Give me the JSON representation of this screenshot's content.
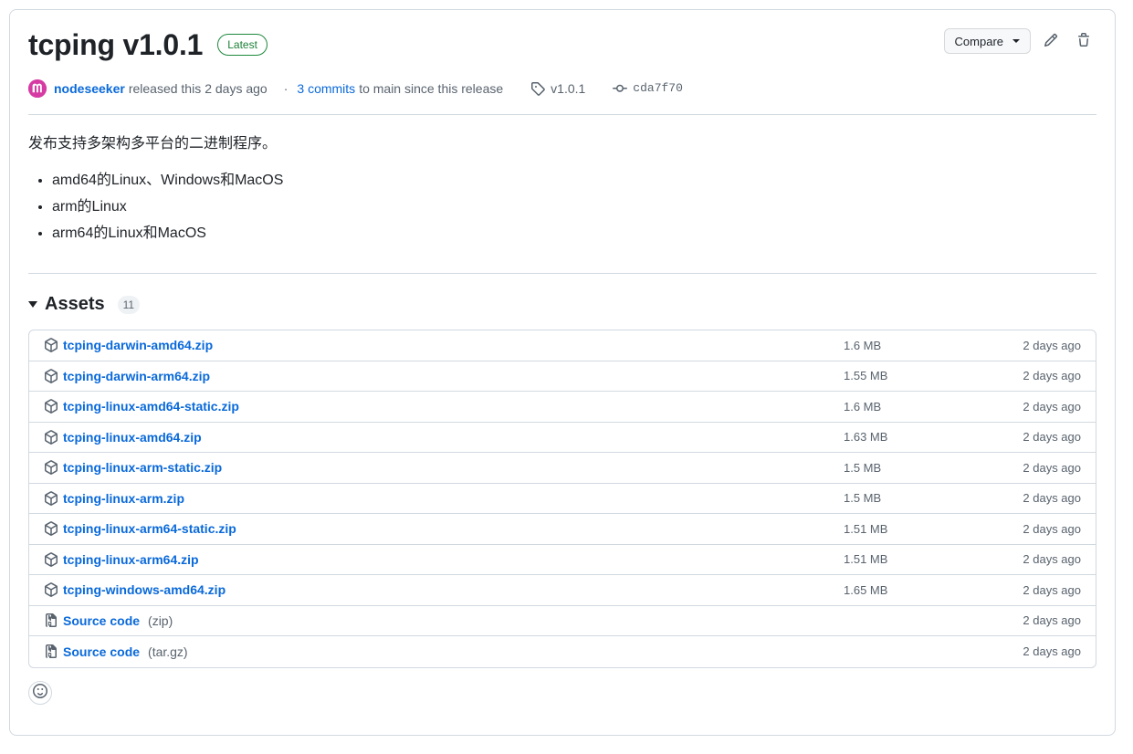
{
  "release": {
    "title": "tcping v1.0.1",
    "latest_badge": "Latest",
    "author": "nodeseeker",
    "released_text": "released this",
    "released_when": "2 days ago",
    "meta_separator": "·",
    "commits_link": "3 commits",
    "commits_tail": "to main since this release",
    "tag_name": "v1.0.1",
    "commit_hash": "cda7f70"
  },
  "actions": {
    "compare_label": "Compare",
    "edit_title": "Edit release",
    "delete_title": "Delete release"
  },
  "body": {
    "paragraph": "发布支持多架构多平台的二进制程序。",
    "bullets": [
      "amd64的Linux、Windows和MacOS",
      "arm的Linux",
      "arm64的Linux和MacOS"
    ]
  },
  "assets": {
    "heading": "Assets",
    "count": "11",
    "rows": [
      {
        "name": "tcping-darwin-amd64.zip",
        "suffix": "",
        "size": "1.6 MB",
        "date": "2 days ago",
        "icon": "package-icon"
      },
      {
        "name": "tcping-darwin-arm64.zip",
        "suffix": "",
        "size": "1.55 MB",
        "date": "2 days ago",
        "icon": "package-icon"
      },
      {
        "name": "tcping-linux-amd64-static.zip",
        "suffix": "",
        "size": "1.6 MB",
        "date": "2 days ago",
        "icon": "package-icon"
      },
      {
        "name": "tcping-linux-amd64.zip",
        "suffix": "",
        "size": "1.63 MB",
        "date": "2 days ago",
        "icon": "package-icon"
      },
      {
        "name": "tcping-linux-arm-static.zip",
        "suffix": "",
        "size": "1.5 MB",
        "date": "2 days ago",
        "icon": "package-icon"
      },
      {
        "name": "tcping-linux-arm.zip",
        "suffix": "",
        "size": "1.5 MB",
        "date": "2 days ago",
        "icon": "package-icon"
      },
      {
        "name": "tcping-linux-arm64-static.zip",
        "suffix": "",
        "size": "1.51 MB",
        "date": "2 days ago",
        "icon": "package-icon"
      },
      {
        "name": "tcping-linux-arm64.zip",
        "suffix": "",
        "size": "1.51 MB",
        "date": "2 days ago",
        "icon": "package-icon"
      },
      {
        "name": "tcping-windows-amd64.zip",
        "suffix": "",
        "size": "1.65 MB",
        "date": "2 days ago",
        "icon": "package-icon"
      },
      {
        "name": "Source code",
        "suffix": "(zip)",
        "size": "",
        "date": "2 days ago",
        "icon": "file-zip-icon"
      },
      {
        "name": "Source code",
        "suffix": "(tar.gz)",
        "size": "",
        "date": "2 days ago",
        "icon": "file-zip-icon"
      }
    ]
  },
  "reactions": {
    "add_label": "Add reaction"
  },
  "colors": {
    "link": "#0969da",
    "badge_green": "#1a7f37",
    "muted": "#59636e",
    "border": "#d1d9e0",
    "avatar": "#d63ba3"
  }
}
